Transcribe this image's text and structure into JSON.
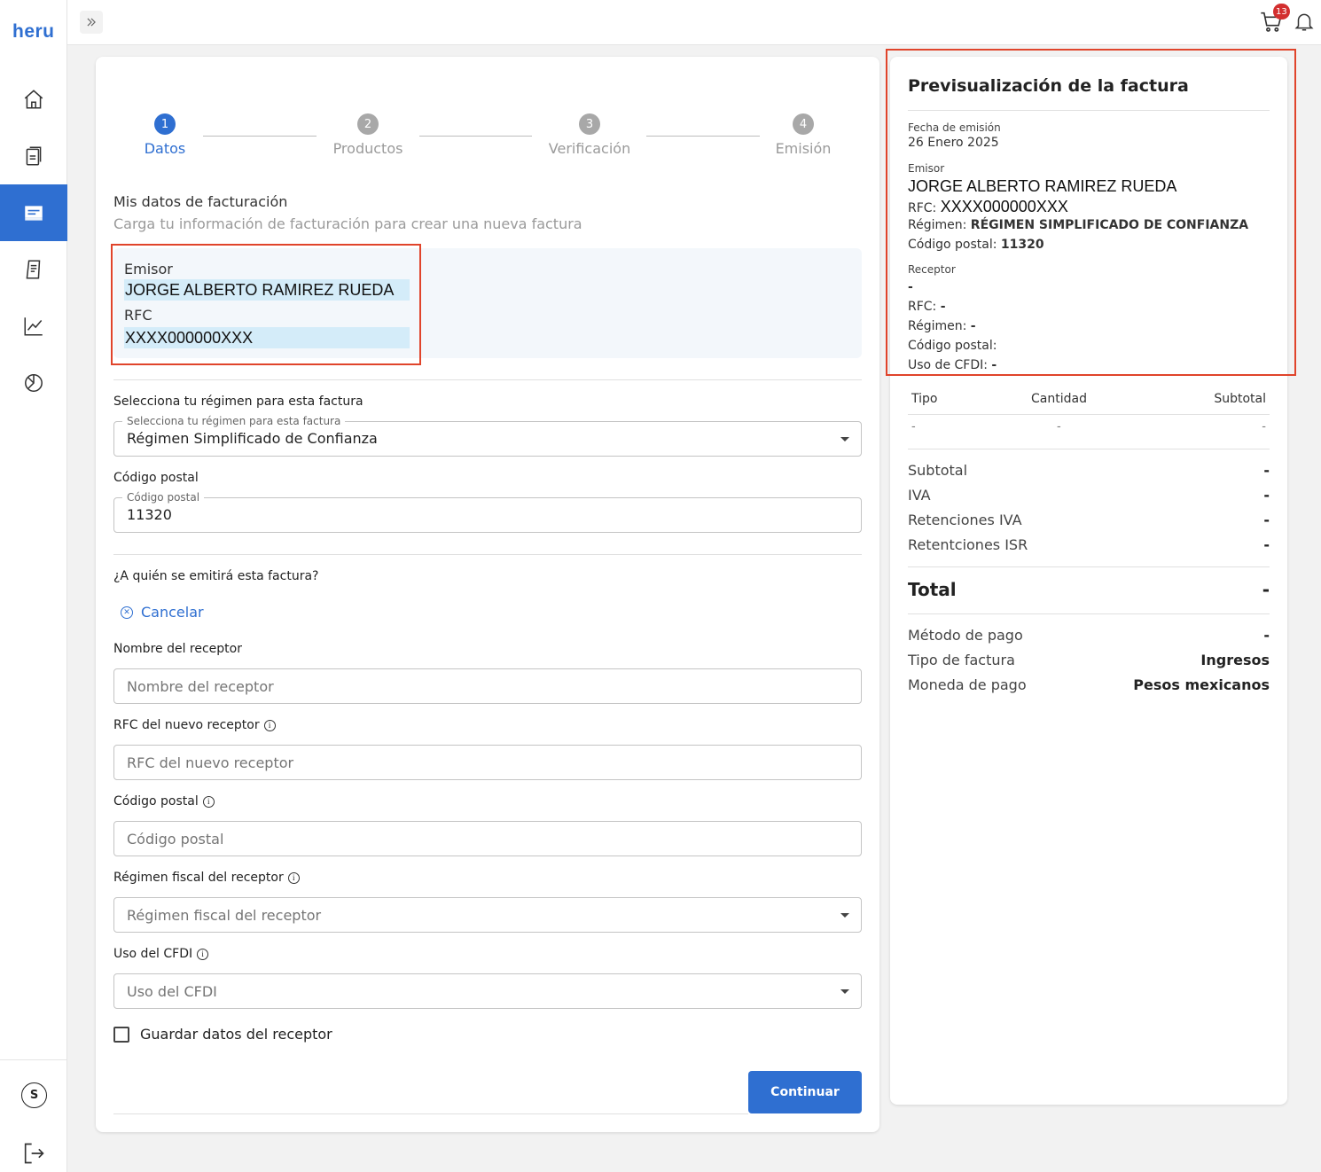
{
  "brand": {
    "logo": "heru",
    "accent": "#2f6fd1"
  },
  "topbar": {
    "cart_count": "13"
  },
  "sidebar": {
    "avatar_initial": "S"
  },
  "stepper": [
    {
      "number": "1",
      "label": "Datos"
    },
    {
      "number": "2",
      "label": "Productos"
    },
    {
      "number": "3",
      "label": "Verificación"
    },
    {
      "number": "4",
      "label": "Emisión"
    }
  ],
  "billing": {
    "title": "Mis datos de facturación",
    "subtitle": "Carga tu información de facturación para crear una nueva factura",
    "emisor_label": "Emisor",
    "emisor_value": "JORGE ALBERTO RAMIREZ RUEDA",
    "rfc_label": "RFC",
    "rfc_value": "XXXX000000XXX"
  },
  "regimen": {
    "label": "Selecciona tu régimen para esta factura",
    "legend": "Selecciona tu régimen para esta factura",
    "value": "Régimen Simplificado de Confianza"
  },
  "cp": {
    "label": "Código postal",
    "legend": "Código postal",
    "value": "11320"
  },
  "receptor": {
    "question": "¿A quién se emitirá esta factura?",
    "cancel": "Cancelar",
    "name_label": "Nombre del receptor",
    "name_placeholder": "Nombre del receptor",
    "rfc_label": "RFC del nuevo receptor",
    "rfc_placeholder": "RFC del nuevo receptor",
    "cp_label": "Código postal",
    "cp_placeholder": "Código postal",
    "regimen_label": "Régimen fiscal del receptor",
    "regimen_placeholder": "Régimen fiscal del receptor",
    "cfdi_label": "Uso del CFDI",
    "cfdi_placeholder": "Uso del CFDI",
    "save_label": "Guardar datos del receptor"
  },
  "continue_label": "Continuar",
  "preview": {
    "title": "Previsualización de la factura",
    "fecha_label": "Fecha de emisión",
    "fecha_value": "26 Enero 2025",
    "emisor_label": "Emisor",
    "emisor_name": "JORGE ALBERTO RAMIREZ RUEDA",
    "rfc_label": "RFC:",
    "rfc_value": "XXXX000000XXX",
    "regimen_label": "Régimen:",
    "regimen_value": "RÉGIMEN SIMPLIFICADO DE CONFIANZA",
    "cp_label": "Código postal:",
    "cp_value": "11320",
    "receptor_label": "Receptor",
    "receptor_name": "-",
    "r_rfc_label": "RFC:",
    "r_rfc_value": "-",
    "r_regimen_label": "Régimen:",
    "r_regimen_value": "-",
    "r_cp_label": "Código postal:",
    "r_cfdi_label": "Uso de CFDI:",
    "r_cfdi_value": "-",
    "table": {
      "headers": [
        "Tipo",
        "Cantidad",
        "Subtotal"
      ],
      "row": [
        "-",
        "-",
        "-"
      ]
    },
    "summary": [
      {
        "label": "Subtotal",
        "value": "-"
      },
      {
        "label": "IVA",
        "value": "-"
      },
      {
        "label": "Retenciones IVA",
        "value": "-"
      },
      {
        "label": "Retentciones ISR",
        "value": "-"
      }
    ],
    "total_label": "Total",
    "total_value": "-",
    "details": [
      {
        "label": "Método de pago",
        "value": "-"
      },
      {
        "label": "Tipo de factura",
        "value": "Ingresos"
      },
      {
        "label": "Moneda de pago",
        "value": "Pesos mexicanos"
      }
    ]
  }
}
